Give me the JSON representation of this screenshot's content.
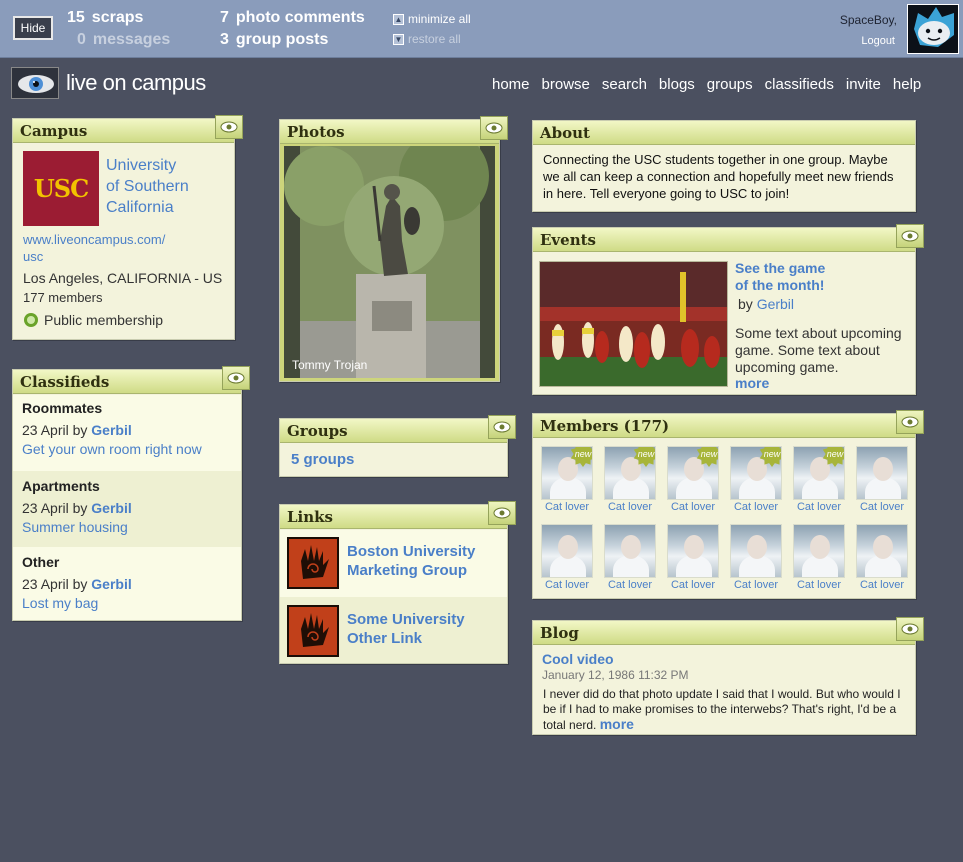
{
  "topbar": {
    "hide_label": "Hide",
    "scraps_count": "15",
    "scraps_label": "scraps",
    "messages_count": "0",
    "messages_label": "messages",
    "photo_comments_count": "7",
    "photo_comments_label": "photo comments",
    "group_posts_count": "3",
    "group_posts_label": "group posts",
    "minimize_all": "minimize all",
    "restore_all": "restore all",
    "username": "SpaceBoy,",
    "logout": "Logout"
  },
  "header": {
    "logo_text": "live on campus",
    "nav": [
      "home",
      "browse",
      "search",
      "blogs",
      "groups",
      "classifieds",
      "invite",
      "help"
    ]
  },
  "campus": {
    "title": "Campus",
    "logo_text": "USC",
    "name_lines": [
      "University",
      "of Southern",
      "California"
    ],
    "url_line1": "www.liveoncampus.com/",
    "url_line2": "usc",
    "location": "Los Angeles, CALIFORNIA - US",
    "members": "177 members",
    "membership": "Public membership"
  },
  "classifieds": {
    "title": "Classifieds",
    "items": [
      {
        "category": "Roommates",
        "date": "23 April by",
        "author": "Gerbil",
        "link": "Get your own room right now"
      },
      {
        "category": "Apartments",
        "date": "23 April by",
        "author": "Gerbil",
        "link": "Summer housing"
      },
      {
        "category": "Other",
        "date": "23 April by",
        "author": "Gerbil",
        "link": "Lost my bag"
      }
    ]
  },
  "photos": {
    "title": "Photos",
    "caption": "Tommy Trojan"
  },
  "groups": {
    "title": "Groups",
    "link": "5 groups"
  },
  "links": {
    "title": "Links",
    "items": [
      {
        "line1": "Boston University",
        "line2": "Marketing Group"
      },
      {
        "line1": "Some University",
        "line2": "Other Link"
      }
    ]
  },
  "about": {
    "title": "About",
    "text": "Connecting the USC students together in one group. Maybe we all can keep a connection and hopefully meet new friends in here. Tell everyone going to USC to join!"
  },
  "events": {
    "title": "Events",
    "headline_line1": "See the game",
    "headline_line2": "of the month!",
    "by": "by",
    "author": "Gerbil",
    "body": "Some text about upcoming game. Some text about upcoming game.",
    "more": "more"
  },
  "members": {
    "title": "Members (177)",
    "label": "Cat lover",
    "new_badge": "new",
    "items": [
      {
        "label": "Cat lover",
        "new": true
      },
      {
        "label": "Cat lover",
        "new": true
      },
      {
        "label": "Cat lover",
        "new": true
      },
      {
        "label": "Cat lover",
        "new": true
      },
      {
        "label": "Cat lover",
        "new": true
      },
      {
        "label": "Cat lover",
        "new": false
      },
      {
        "label": "Cat lover",
        "new": false
      },
      {
        "label": "Cat lover",
        "new": false
      },
      {
        "label": "Cat lover",
        "new": false
      },
      {
        "label": "Cat lover",
        "new": false
      },
      {
        "label": "Cat lover",
        "new": false
      },
      {
        "label": "Cat lover",
        "new": false
      }
    ]
  },
  "blog": {
    "title": "Blog",
    "post_title": "Cool video",
    "date": "January 12, 1986  11:32 PM",
    "body": "I never did do that photo update I said that I would. But who would I be if I had to make promises to the interwebs? That's right, I'd be a total nerd.",
    "more": "more"
  },
  "colors": {
    "background": "#4b5060",
    "topbar": "#8a9cbb",
    "panel": "#f3f3dc",
    "link": "#4a7fc8",
    "title_gradient_bottom": "#cfdb86"
  }
}
